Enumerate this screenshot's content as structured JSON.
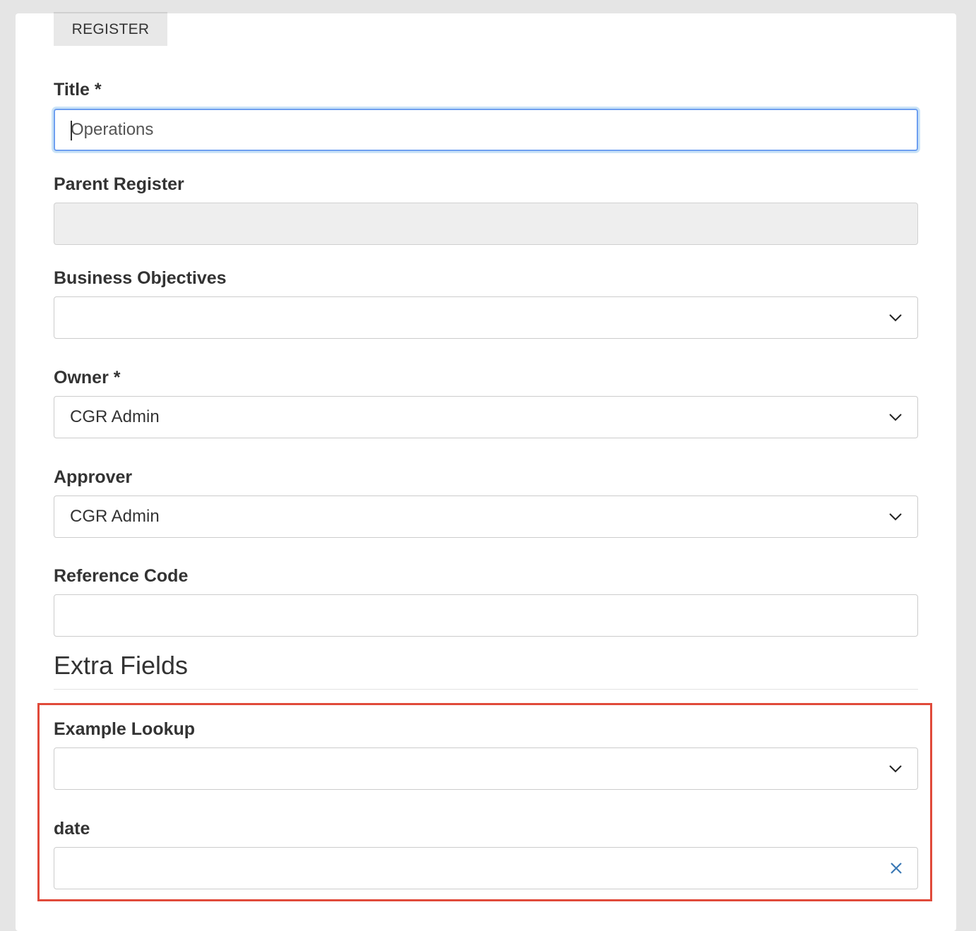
{
  "tab": {
    "label": "REGISTER"
  },
  "fields": {
    "title": {
      "label": "Title *",
      "value": "Operations"
    },
    "parent_register": {
      "label": "Parent Register",
      "value": ""
    },
    "business_objectives": {
      "label": "Business Objectives",
      "value": ""
    },
    "owner": {
      "label": "Owner *",
      "value": "CGR Admin"
    },
    "approver": {
      "label": "Approver",
      "value": "CGR Admin"
    },
    "reference_code": {
      "label": "Reference Code",
      "value": ""
    }
  },
  "extra": {
    "heading": "Extra Fields",
    "example_lookup": {
      "label": "Example Lookup",
      "value": ""
    },
    "date": {
      "label": "date",
      "value": ""
    }
  },
  "colors": {
    "highlight_border": "#e04a3a",
    "focus_border": "#6e9ff0",
    "clear_icon": "#3a78b5"
  },
  "icons": {
    "select_chevron": "chevron-down-icon",
    "date_clear": "close-icon"
  }
}
